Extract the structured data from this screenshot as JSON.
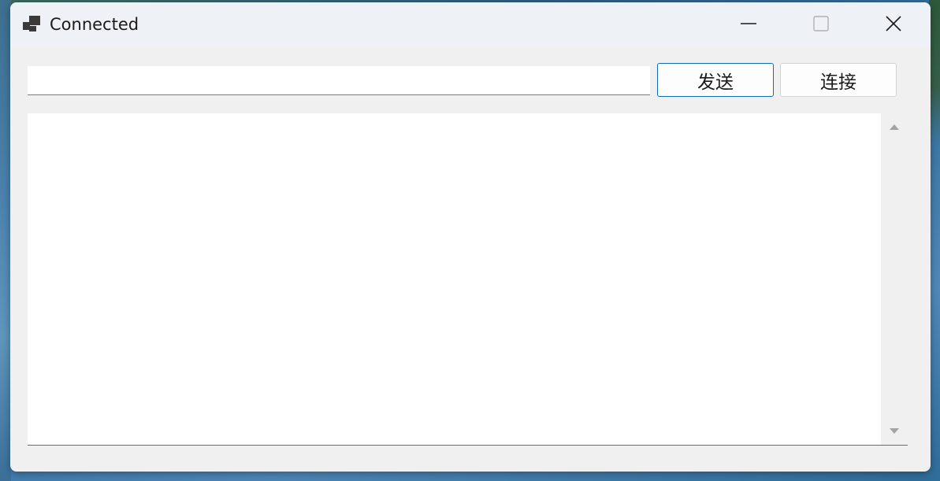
{
  "window": {
    "title": "Connected",
    "icon": "app-window-icon"
  },
  "caption_buttons": {
    "minimize": "minimize-icon",
    "maximize": "maximize-icon",
    "close": "close-icon"
  },
  "toolbar": {
    "message_value": "",
    "message_placeholder": "",
    "send_label": "发送",
    "connect_label": "连接"
  },
  "log": {
    "content": ""
  },
  "colors": {
    "accent": "#0f6cbd",
    "window_bg": "#f0f0f0",
    "titlebar_bg": "#eef1f6"
  }
}
